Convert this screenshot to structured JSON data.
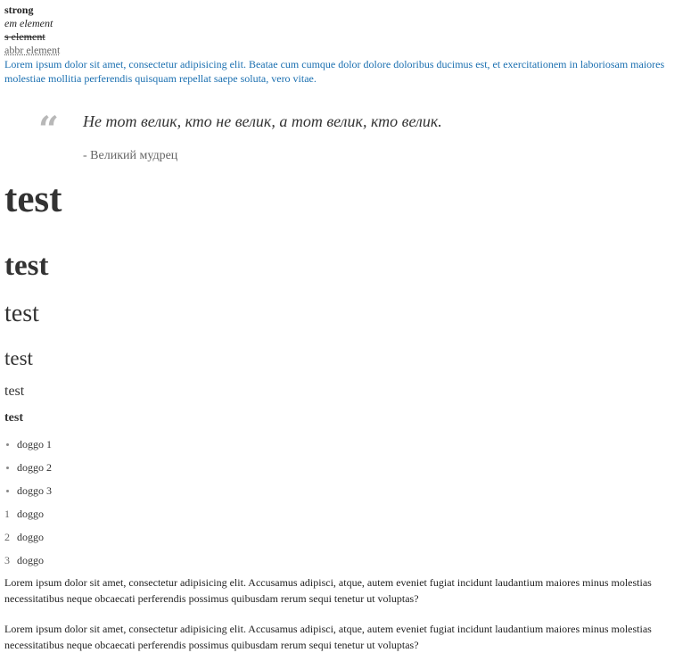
{
  "inline": {
    "strong": "strong",
    "em": "em element",
    "s": "s element",
    "abbr": "abbr element"
  },
  "link_paragraph": "Lorem ipsum dolor sit amet, consectetur adipisicing elit. Beatae cum cumque dolor dolore doloribus ducimus est, et exercitationem in laboriosam maiores molestiae mollitia perferendis quisquam repellat saepe soluta, vero vitae.",
  "quote": {
    "mark": "“",
    "text": "Не тот велик, кто не велик, а тот велик, кто велик.",
    "author": "- Великий мудрец"
  },
  "headings": {
    "h1": "test",
    "h2": "test",
    "h3": "test",
    "h4": "test",
    "h5": "test",
    "h6": "test"
  },
  "unordered_list": [
    "doggo 1",
    "doggo 2",
    "doggo 3"
  ],
  "ordered_list": {
    "numbers": [
      "1",
      "2",
      "3"
    ],
    "items": [
      "doggo",
      "doggo",
      "doggo"
    ]
  },
  "paragraphs": [
    "Lorem ipsum dolor sit amet, consectetur adipisicing elit. Accusamus adipisci, atque, autem eveniet fugiat incidunt laudantium maiores minus molestias necessitatibus neque obcaecati perferendis possimus quibusdam rerum sequi tenetur ut voluptas?",
    "Lorem ipsum dolor sit amet, consectetur adipisicing elit. Accusamus adipisci, atque, autem eveniet fugiat incidunt laudantium maiores minus molestias necessitatibus neque obcaecati perferendis possimus quibusdam rerum sequi tenetur ut voluptas?"
  ],
  "colors": {
    "link": "#1a6fb0",
    "text": "#333333",
    "quote_mark": "#b8b8b8"
  }
}
